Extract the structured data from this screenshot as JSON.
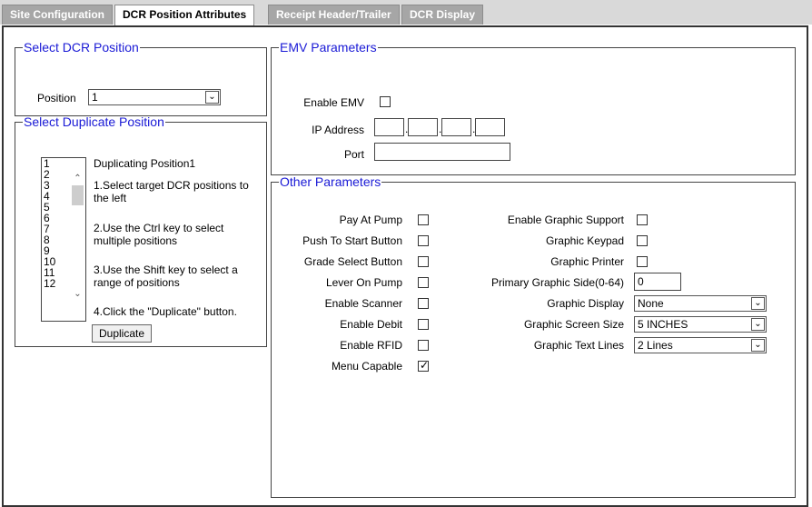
{
  "tabs": [
    {
      "label": "Site Configuration"
    },
    {
      "label": "DCR Position Attributes"
    },
    {
      "label": "Receipt Header/Trailer"
    },
    {
      "label": "DCR Display"
    }
  ],
  "select_position": {
    "legend": "Select DCR Position",
    "label": "Position",
    "value": "1"
  },
  "duplicate": {
    "legend": "Select Duplicate Position",
    "list": [
      "1",
      "2",
      "3",
      "4",
      "5",
      "6",
      "7",
      "8",
      "9",
      "10",
      "11",
      "12"
    ],
    "heading": "Duplicating Position1",
    "step1": "1.Select target DCR positions to the left",
    "step2": "2.Use the Ctrl key to select multiple positions",
    "step3": "3.Use the Shift key to select a range of positions",
    "step4": "4.Click the \"Duplicate\" button.",
    "button": "Duplicate"
  },
  "emv": {
    "legend": "EMV Parameters",
    "enable_label": "Enable EMV",
    "enable_checked": false,
    "ip_label": "IP Address",
    "port_label": "Port",
    "ip_parts": [
      "",
      "",
      "",
      ""
    ],
    "port_value": ""
  },
  "other": {
    "legend": "Other Parameters",
    "left": [
      {
        "label": "Pay At Pump",
        "checked": false
      },
      {
        "label": "Push To Start Button",
        "checked": false
      },
      {
        "label": "Grade Select Button",
        "checked": false
      },
      {
        "label": "Lever On Pump",
        "checked": false
      },
      {
        "label": "Enable Scanner",
        "checked": false
      },
      {
        "label": "Enable Debit",
        "checked": false
      },
      {
        "label": "Enable RFID",
        "checked": false
      },
      {
        "label": "Menu Capable",
        "checked": true
      }
    ],
    "right_checks": [
      {
        "label": "Enable Graphic Support",
        "checked": false
      },
      {
        "label": "Graphic Keypad",
        "checked": false
      },
      {
        "label": "Graphic Printer",
        "checked": false
      }
    ],
    "primary_side_label": "Primary Graphic Side(0-64)",
    "primary_side_value": "0",
    "display_label": "Graphic Display",
    "display_value": "None",
    "screen_label": "Graphic Screen Size",
    "screen_value": "5 INCHES",
    "lines_label": "Graphic Text Lines",
    "lines_value": "2 Lines"
  }
}
